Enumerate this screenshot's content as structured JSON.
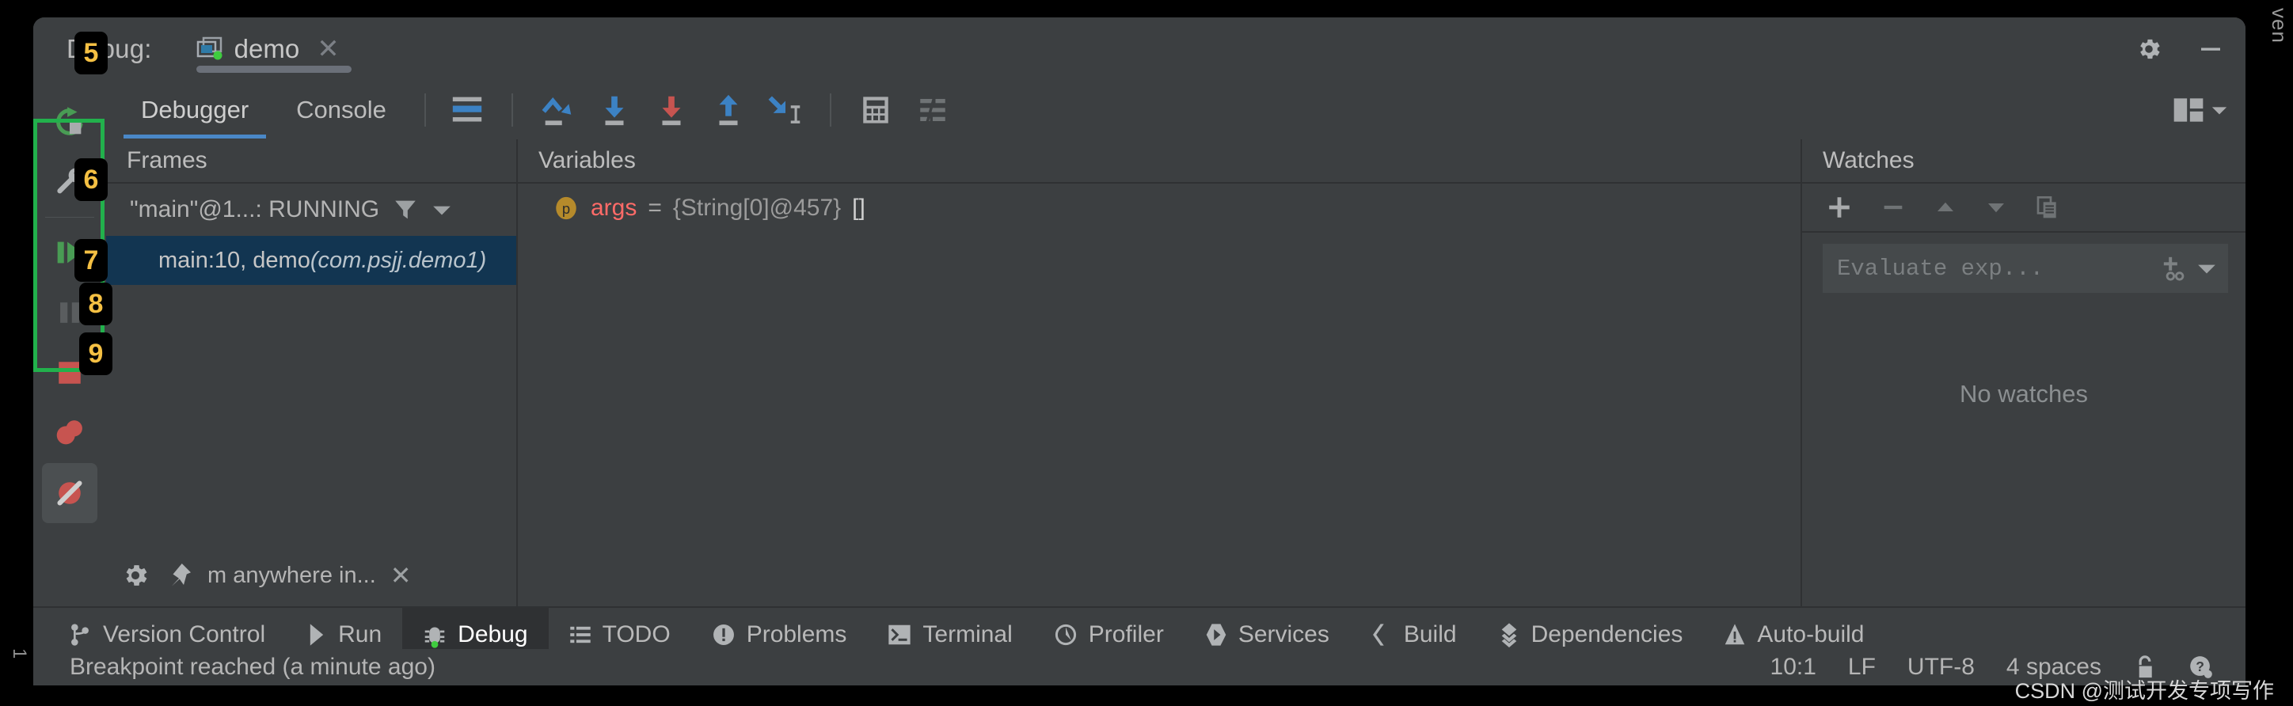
{
  "window": {
    "title_label": "Debug:",
    "tab_name": "demo",
    "close_icon": "close-icon",
    "settings_icon": "gear-icon",
    "minimize_icon": "minimize-icon"
  },
  "edge": {
    "right_vertical_text": "ven",
    "left_vertical_text": "1"
  },
  "tabstrip": {
    "tabs": [
      {
        "label": "Debugger",
        "selected": true
      },
      {
        "label": "Console",
        "selected": false
      }
    ],
    "stepping_icons": [
      {
        "name": "show-execution-point-icon",
        "color": "#4a90c4"
      },
      {
        "name": "step-over-icon",
        "color": "#4a90c4"
      },
      {
        "name": "step-into-icon",
        "color": "#4a90c4"
      },
      {
        "name": "force-step-into-icon",
        "color": "#c75450"
      },
      {
        "name": "step-out-icon",
        "color": "#4a90c4"
      },
      {
        "name": "run-to-cursor-icon",
        "color": "#4a90c4"
      }
    ],
    "right_icons": [
      {
        "name": "evaluate-expression-icon"
      },
      {
        "name": "settings-sliders-icon"
      }
    ],
    "layout_icon": "layout-settings-icon"
  },
  "left_toolbar": {
    "buttons": [
      {
        "name": "rerun-button",
        "icon": "rerun-icon",
        "color": "#499c54"
      },
      {
        "name": "edit-configurations-button",
        "icon": "wrench-icon",
        "color": "#afb1b3"
      },
      {
        "name": "resume-program-button",
        "icon": "resume-icon",
        "color": "#499c54"
      },
      {
        "name": "pause-program-button",
        "icon": "pause-icon",
        "color": "#5a5d5f"
      },
      {
        "name": "stop-button",
        "icon": "stop-square-icon",
        "color": "#c75450"
      },
      {
        "name": "view-breakpoints-button",
        "icon": "breakpoints-icon",
        "color": "#c75450"
      },
      {
        "name": "mute-breakpoints-button",
        "icon": "mute-breakpoints-icon",
        "color": "#c75450",
        "active": true
      }
    ],
    "highlight_color": "#22b14c"
  },
  "badges": [
    {
      "id": "5",
      "label": "5"
    },
    {
      "id": "6",
      "label": "6"
    },
    {
      "id": "7",
      "label": "7"
    },
    {
      "id": "8",
      "label": "8"
    },
    {
      "id": "9",
      "label": "9"
    }
  ],
  "frames": {
    "header": "Frames",
    "thread": "\"main\"@1...: RUNNING",
    "filter_icon": "filter-icon",
    "dropdown_icon": "chevron-down-icon",
    "rows": [
      {
        "text": "main:10, demo ",
        "detail": "(com.psjj.demo1)",
        "selected": true
      }
    ]
  },
  "variables": {
    "header": "Variables",
    "rows": [
      {
        "badge": "p",
        "badge_color": "#b58a2b",
        "name": "args",
        "equals": "=",
        "type": "{String[0]@457}",
        "value": "[]"
      }
    ]
  },
  "watches": {
    "header": "Watches",
    "toolbar_icons": [
      {
        "name": "add-watch-icon",
        "glyph": "+"
      },
      {
        "name": "remove-watch-icon",
        "glyph": "−"
      },
      {
        "name": "move-up-icon",
        "glyph": "▲"
      },
      {
        "name": "move-down-icon",
        "glyph": "▼"
      },
      {
        "name": "copy-icon",
        "glyph": "copy"
      }
    ],
    "evaluate_placeholder": "Evaluate exp...",
    "evaluate_value": "",
    "add-to-watches_icon": "add-to-watches-icon",
    "history_icon": "chevron-down-icon",
    "empty_text": "No watches"
  },
  "inline_search": {
    "gear_icon": "gear-icon",
    "pin_icon": "pin-icon",
    "text": "m anywhere in...",
    "close_icon": "close-icon"
  },
  "toolwindow_bar": {
    "items": [
      {
        "label": "Version Control",
        "icon": "branch-icon",
        "active": false
      },
      {
        "label": "Run",
        "icon": "play-icon",
        "active": false
      },
      {
        "label": "Debug",
        "icon": "bug-icon",
        "active": true
      },
      {
        "label": "TODO",
        "icon": "list-icon",
        "active": false
      },
      {
        "label": "Problems",
        "icon": "error-circle-icon",
        "active": false
      },
      {
        "label": "Terminal",
        "icon": "terminal-icon",
        "active": false
      },
      {
        "label": "Profiler",
        "icon": "profiler-icon",
        "active": false
      },
      {
        "label": "Services",
        "icon": "services-icon",
        "active": false
      },
      {
        "label": "Build",
        "icon": "build-hammer-icon",
        "active": false
      },
      {
        "label": "Dependencies",
        "icon": "dependencies-icon",
        "active": false
      },
      {
        "label": "Auto-build",
        "icon": "warning-triangle-icon",
        "active": false
      }
    ]
  },
  "statusbar": {
    "message": "Breakpoint reached (a minute ago)",
    "caret_position": "10:1",
    "line_separator": "LF",
    "encoding": "UTF-8",
    "indent": "4 spaces",
    "lock_icon": "unlocked-icon",
    "help_icon": "help-icon"
  },
  "watermark": "CSDN @测试开发专项写作"
}
